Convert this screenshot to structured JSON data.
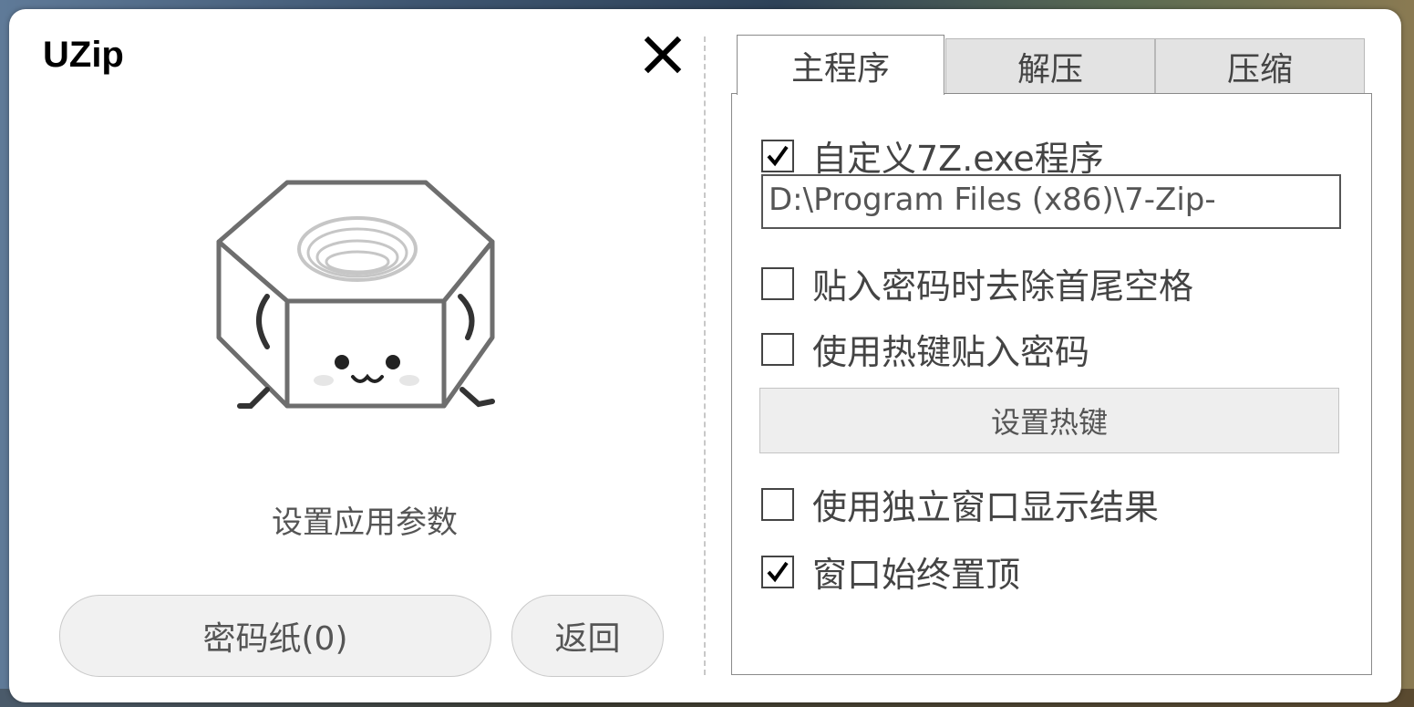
{
  "window": {
    "title": "UZip",
    "close_icon": "close-icon"
  },
  "left_panel": {
    "mascot_icon": "hex-nut-mascot-icon",
    "caption": "设置应用参数",
    "password_paper_button": "密码纸(0)",
    "back_button": "返回"
  },
  "tabs": [
    {
      "label": "主程序",
      "active": true
    },
    {
      "label": "解压",
      "active": false
    },
    {
      "label": "压缩",
      "active": false
    }
  ],
  "main_tab": {
    "custom_7z": {
      "label": "自定义7Z.exe程序",
      "checked": true
    },
    "path_value": "D:\\Program Files (x86)\\7-Zip-",
    "trim_spaces": {
      "label": "贴入密码时去除首尾空格",
      "checked": false
    },
    "hotkey_paste": {
      "label": "使用热键贴入密码",
      "checked": false
    },
    "set_hotkey_button": "设置热键",
    "standalone_window": {
      "label": "使用独立窗口显示结果",
      "checked": false
    },
    "always_on_top": {
      "label": "窗口始终置顶",
      "checked": true
    }
  },
  "colors": {
    "accent_border": "#8a8a8a",
    "button_bg": "#f1f1f1",
    "text": "#444444"
  }
}
